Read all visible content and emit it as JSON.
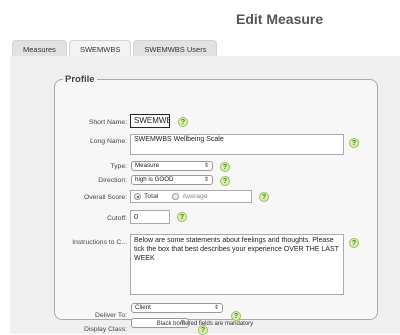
{
  "page": {
    "title": "Edit Measure"
  },
  "tabs": [
    {
      "label": "Measures",
      "active": false
    },
    {
      "label": "SWEMWBS",
      "active": true
    },
    {
      "label": "SWEMWBS Users",
      "active": false
    }
  ],
  "profile": {
    "legend": "Profile",
    "short_name": {
      "label": "Short Name:",
      "value": "SWEMWB"
    },
    "long_name": {
      "label": "Long Name:",
      "value": "SWEMWBS Wellbeing Scale"
    },
    "type": {
      "label": "Type:",
      "value": "Measure"
    },
    "direction": {
      "label": "Direction:",
      "value": "high is GOOD"
    },
    "overall_score": {
      "label": "Overall Score:",
      "options": [
        "Total",
        "Average"
      ],
      "selected": "Total"
    },
    "cutoff": {
      "label": "Cutoff:",
      "value": "0"
    },
    "instructions": {
      "label": "Instructions to C...",
      "value": "Below are some statements about feelings and thoughts. Please tick the box that best describes your experience OVER THE LAST WEEK"
    },
    "deliver_to": {
      "label": "Deliver To:",
      "value": "Client"
    },
    "display_class": {
      "label": "Display Class:",
      "value": ""
    },
    "help_glyph": "?"
  },
  "footer": {
    "mandatory_note": "Black bordered fields are mandatory"
  },
  "icons": {
    "help": "help-icon",
    "select_arrow": "updown-arrows-icon"
  }
}
